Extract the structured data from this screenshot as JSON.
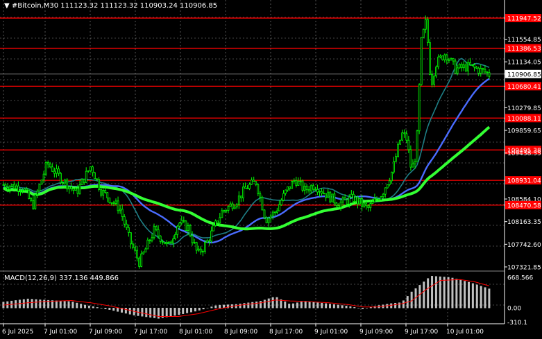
{
  "symbol": {
    "caret": "▼",
    "name": "#Bitcoin,M30",
    "ohlc": "111123.32 111123.32 110903.24 110906.85"
  },
  "macd_label": "MACD(12,26,9) 337.136 449.866",
  "colors": {
    "background": "#000000",
    "grid": "#ffffff",
    "candle": "#00ff00",
    "level": "#ff0000",
    "ma_fast": "#1e7f86",
    "ma_mid": "#4a6cff",
    "ma_slow": "#33ff33",
    "macd_hist": "#c0c0c0",
    "macd_signal": "#ff0000"
  },
  "chart_data": {
    "type": "candlestick",
    "price_axis": [
      "111947.52",
      "111554.85",
      "111386.53",
      "111134.05",
      "110906.85",
      "110680.41",
      "110279.85",
      "110088.11",
      "109859.65",
      "109495.38",
      "109438.55",
      "108931.04",
      "108584.10",
      "108470.58",
      "108163.35",
      "107742.60",
      "107321.85"
    ],
    "horizontal_levels": [
      111947.52,
      111386.53,
      110680.41,
      110088.11,
      109495.38,
      108931.04,
      108470.58
    ],
    "current_price": 110906.85,
    "ylim": [
      107321.85,
      112180
    ],
    "time_axis": [
      "6 Jul 2025",
      "7 Jul 01:00",
      "7 Jul 09:00",
      "7 Jul 17:00",
      "8 Jul 01:00",
      "8 Jul 09:00",
      "8 Jul 17:00",
      "9 Jul 01:00",
      "9 Jul 09:00",
      "9 Jul 17:00",
      "10 Jul 01:00"
    ],
    "close_path": [
      [
        0,
        108850
      ],
      [
        4,
        108800
      ],
      [
        6,
        108450
      ],
      [
        9,
        109250
      ],
      [
        12,
        108950
      ],
      [
        15,
        108700
      ],
      [
        18,
        109200
      ],
      [
        20,
        108750
      ],
      [
        24,
        108400
      ],
      [
        26,
        107800
      ],
      [
        28,
        107400
      ],
      [
        31,
        108000
      ],
      [
        34,
        107700
      ],
      [
        36,
        108150
      ],
      [
        38,
        108050
      ],
      [
        40,
        107550
      ],
      [
        42,
        107800
      ],
      [
        45,
        108350
      ],
      [
        48,
        108550
      ],
      [
        50,
        108800
      ],
      [
        52,
        108900
      ],
      [
        54,
        108200
      ],
      [
        56,
        108350
      ],
      [
        58,
        108700
      ],
      [
        60,
        108950
      ],
      [
        62,
        108750
      ],
      [
        64,
        108850
      ],
      [
        66,
        108700
      ],
      [
        69,
        108500
      ],
      [
        72,
        108600
      ],
      [
        75,
        108400
      ],
      [
        78,
        108700
      ],
      [
        80,
        109100
      ],
      [
        82,
        109800
      ],
      [
        83,
        109700
      ],
      [
        84,
        109100
      ],
      [
        85,
        109450
      ],
      [
        86,
        111500
      ],
      [
        87,
        111900
      ],
      [
        88,
        110700
      ],
      [
        89,
        111100
      ],
      [
        91,
        111300
      ],
      [
        93,
        111000
      ],
      [
        96,
        111050
      ],
      [
        99,
        110950
      ],
      [
        100,
        110900
      ]
    ],
    "macd": {
      "axis": [
        "668.566",
        "0.00",
        "-310.1"
      ],
      "hist_path": [
        [
          0,
          130
        ],
        [
          5,
          200
        ],
        [
          9,
          170
        ],
        [
          14,
          140
        ],
        [
          17,
          60
        ],
        [
          22,
          -40
        ],
        [
          27,
          -160
        ],
        [
          32,
          -230
        ],
        [
          36,
          -150
        ],
        [
          40,
          -60
        ],
        [
          44,
          60
        ],
        [
          48,
          80
        ],
        [
          53,
          150
        ],
        [
          56,
          250
        ],
        [
          59,
          80
        ],
        [
          62,
          150
        ],
        [
          67,
          90
        ],
        [
          71,
          40
        ],
        [
          74,
          -20
        ],
        [
          77,
          50
        ],
        [
          80,
          100
        ],
        [
          82,
          120
        ],
        [
          84,
          350
        ],
        [
          88,
          700
        ],
        [
          92,
          670
        ],
        [
          96,
          560
        ],
        [
          100,
          420
        ]
      ],
      "signal_path": [
        [
          0,
          60
        ],
        [
          5,
          110
        ],
        [
          9,
          140
        ],
        [
          14,
          160
        ],
        [
          18,
          110
        ],
        [
          22,
          40
        ],
        [
          27,
          -80
        ],
        [
          32,
          -190
        ],
        [
          36,
          -190
        ],
        [
          40,
          -130
        ],
        [
          44,
          -30
        ],
        [
          48,
          50
        ],
        [
          53,
          110
        ],
        [
          56,
          170
        ],
        [
          59,
          150
        ],
        [
          62,
          140
        ],
        [
          67,
          110
        ],
        [
          71,
          70
        ],
        [
          74,
          20
        ],
        [
          77,
          20
        ],
        [
          80,
          60
        ],
        [
          82,
          90
        ],
        [
          84,
          150
        ],
        [
          87,
          400
        ],
        [
          90,
          600
        ],
        [
          94,
          620
        ],
        [
          97,
          570
        ],
        [
          100,
          480
        ]
      ]
    }
  }
}
